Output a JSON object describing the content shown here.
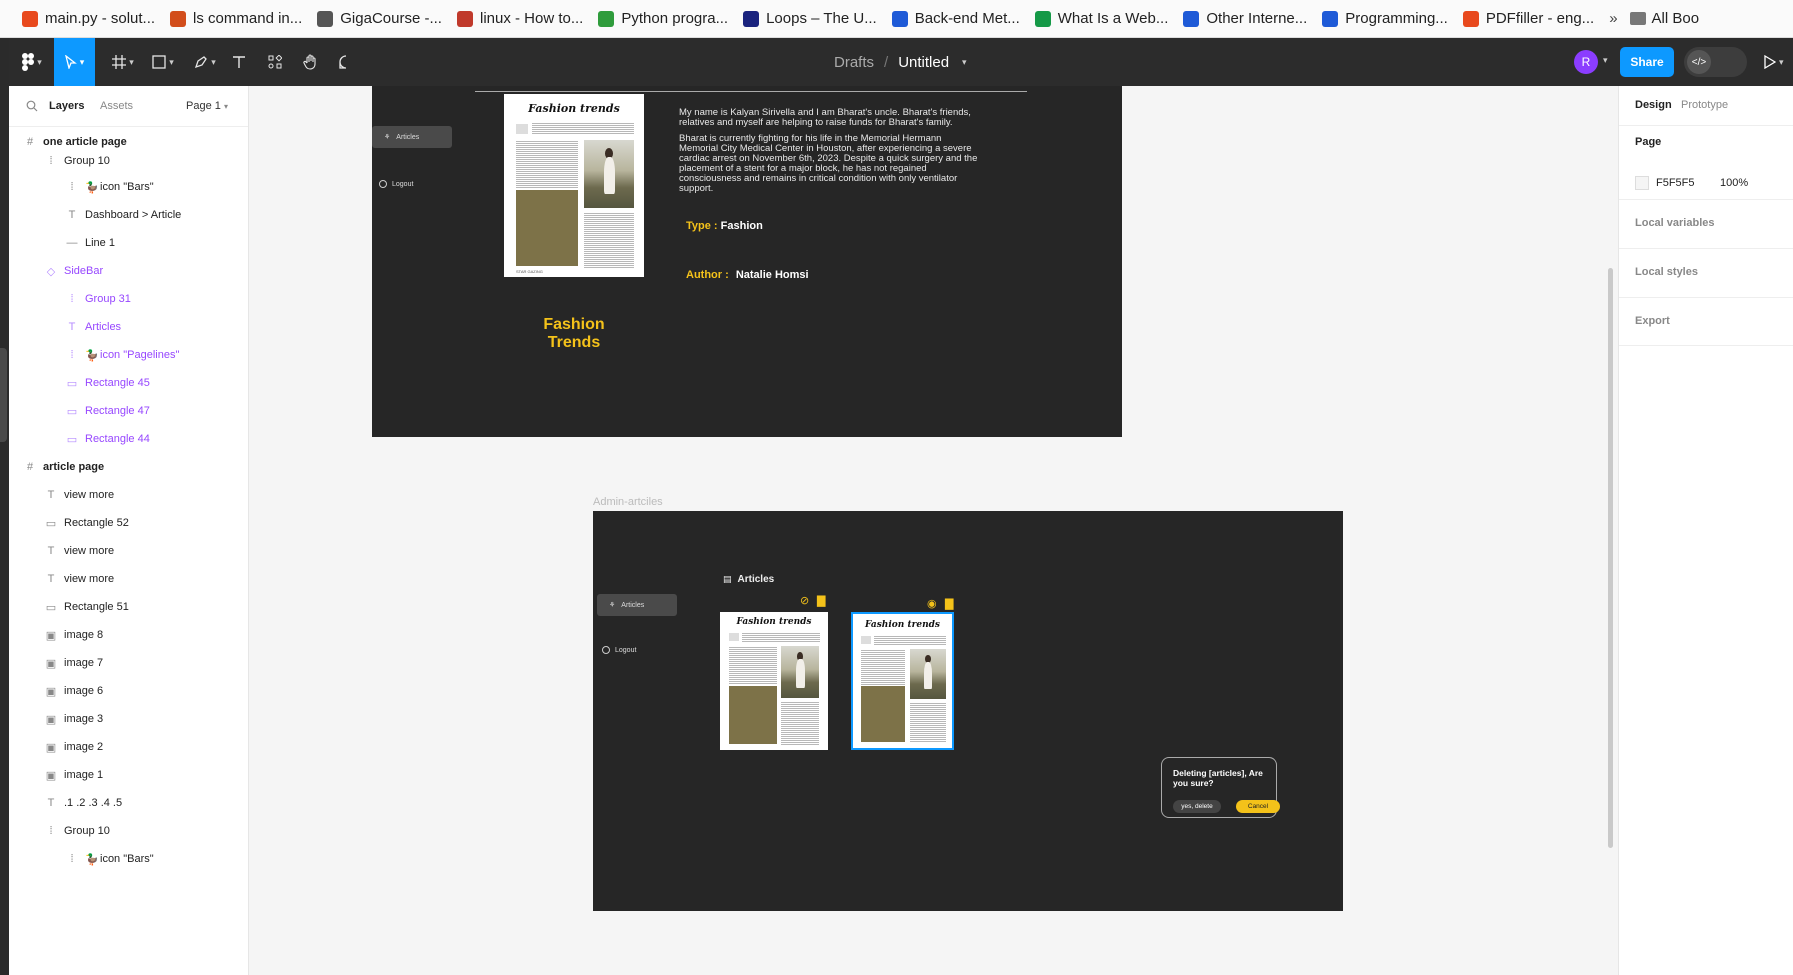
{
  "bookmarks": [
    {
      "label": "main.py - solut...",
      "color": "#e8491d"
    },
    {
      "label": "ls command in...",
      "color": "#d24d1b"
    },
    {
      "label": "GigaCourse -...",
      "color": "#555555"
    },
    {
      "label": "linux - How to...",
      "color": "#c0392b"
    },
    {
      "label": "Python progra...",
      "color": "#2f9c3c"
    },
    {
      "label": "Loops – The U...",
      "color": "#1a237e"
    },
    {
      "label": "Back-end Met...",
      "color": "#1e5ad7"
    },
    {
      "label": "What Is a Web...",
      "color": "#159947"
    },
    {
      "label": "Other Interne...",
      "color": "#1e5ad7"
    },
    {
      "label": "Programming...",
      "color": "#1e5ad7"
    },
    {
      "label": "PDFfiller - eng...",
      "color": "#e8491d"
    }
  ],
  "bookmarks_more": "»",
  "bookmarks_all": "All Boo",
  "toolbar": {
    "drafts": "Drafts",
    "slash": "/",
    "file_title": "Untitled",
    "avatar": "R",
    "share": "Share"
  },
  "layers_panel": {
    "tab_layers": "Layers",
    "tab_assets": "Assets",
    "page_selector": "Page 1",
    "rows": [
      {
        "label": "one article page",
        "icon": "#"
      },
      {
        "label": "Group 10",
        "icon": "⁞"
      },
      {
        "label": "icon \"Bars\"",
        "icon": "⁞"
      },
      {
        "label": "Dashboard > Article",
        "icon": "T"
      },
      {
        "label": "Line 1",
        "icon": "—"
      },
      {
        "label": "SideBar",
        "icon": "◇"
      },
      {
        "label": "Group 31",
        "icon": "⁞"
      },
      {
        "label": "Articles",
        "icon": "T"
      },
      {
        "label": "icon \"Pagelines\"",
        "icon": "⁞"
      },
      {
        "label": "Rectangle 45",
        "icon": "▭"
      },
      {
        "label": "Rectangle 47",
        "icon": "▭"
      },
      {
        "label": "Rectangle 44",
        "icon": "▭"
      },
      {
        "label": "article page",
        "icon": "#"
      },
      {
        "label": "view more",
        "icon": "T"
      },
      {
        "label": "Rectangle 52",
        "icon": "▭"
      },
      {
        "label": "view more",
        "icon": "T"
      },
      {
        "label": "view more",
        "icon": "T"
      },
      {
        "label": "Rectangle 51",
        "icon": "▭"
      },
      {
        "label": "image 8",
        "icon": "▣"
      },
      {
        "label": "image 7",
        "icon": "▣"
      },
      {
        "label": "image 6",
        "icon": "▣"
      },
      {
        "label": "image 3",
        "icon": "▣"
      },
      {
        "label": "image 2",
        "icon": "▣"
      },
      {
        "label": "image 1",
        "icon": "▣"
      },
      {
        "label": ".1 .2 .3 .4 .5",
        "icon": "T"
      },
      {
        "label": "Group 10",
        "icon": "⁞"
      },
      {
        "label": "icon \"Bars\"",
        "icon": "⁞"
      }
    ]
  },
  "frame1": {
    "sidebar_articles": "Articles",
    "sidebar_logout": "Logout",
    "magazine_title": "Fashion trends",
    "magazine_footer": "STAR GAZING",
    "bio_p1": "My name is Kalyan Sirivella and I am Bharat's uncle. Bharat's friends, relatives and myself are helping to raise funds for Bharat's family.",
    "bio_p2": "Bharat is currently fighting for his life in the Memorial Hermann Memorial City Medical Center in Houston, after experiencing a severe cardiac arrest on November 6th, 2023. Despite a quick surgery and the placement of a stent for a major block, he has not regained consciousness and remains in critical condition with only ventilator support.",
    "type_key": "Type :",
    "type_val": "Fashion",
    "author_key": "Author :",
    "author_val": "Natalie Homsi",
    "caption": "Fashion Trends"
  },
  "frame2": {
    "label": "Admin-artciles",
    "sidebar_articles": "Articles",
    "sidebar_logout": "Logout",
    "header": "Articles",
    "card_title": "Fashion trends",
    "dialog_question": "Deleting [articles], Are you sure?",
    "dialog_yes": "yes, delete",
    "dialog_cancel": "Cancel"
  },
  "design_panel": {
    "tab_design": "Design",
    "tab_prototype": "Prototype",
    "page_label": "Page",
    "page_color": "F5F5F5",
    "page_opacity": "100%",
    "local_variables": "Local variables",
    "local_styles": "Local styles",
    "export": "Export"
  },
  "colors": {
    "accent": "#0d99ff",
    "brand_yellow": "#f4c21a",
    "component_purple": "#9747ff"
  }
}
